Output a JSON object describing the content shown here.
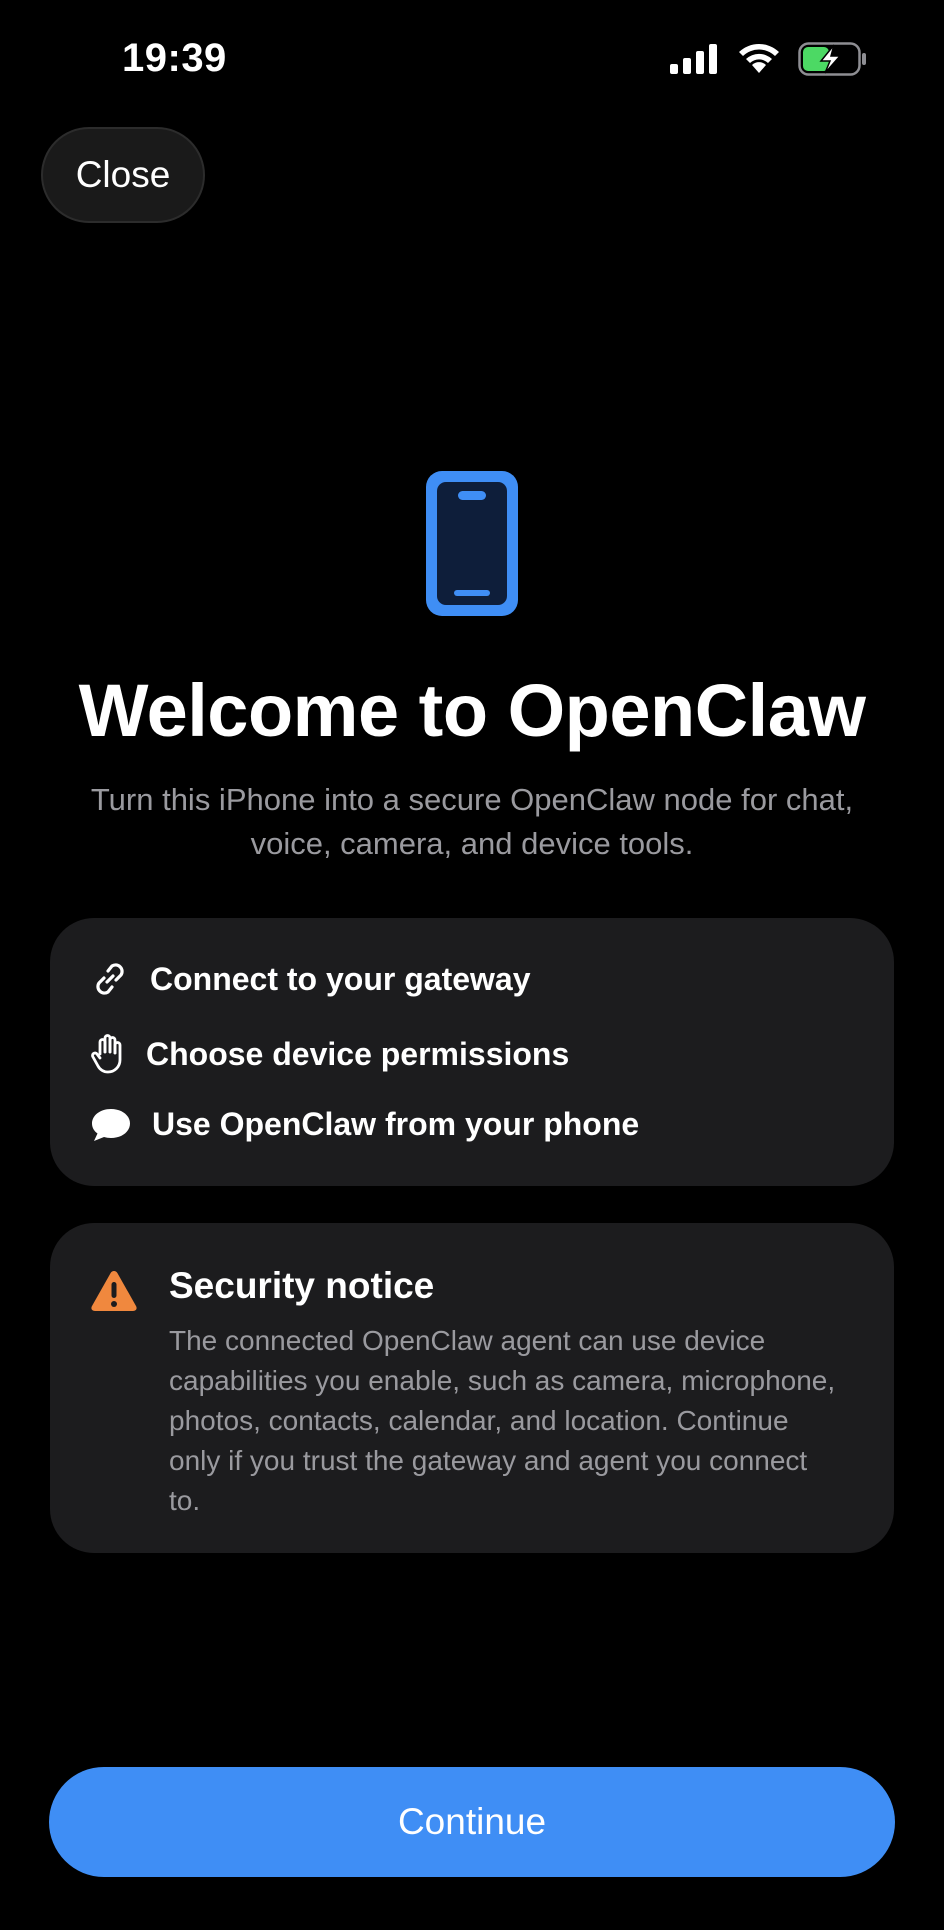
{
  "status_bar": {
    "time": "19:39",
    "icons": [
      "cellular-signal-icon",
      "wifi-icon",
      "battery-charging-icon"
    ],
    "battery_color": "#4cd964"
  },
  "close_button": {
    "label": "Close"
  },
  "hero": {
    "icon": "iphone-icon",
    "icon_color": "#3f8ef5",
    "title": "Welcome to OpenClaw",
    "subtitle": "Turn this iPhone into a secure OpenClaw node for chat, voice, camera, and device tools."
  },
  "features": [
    {
      "icon": "link-icon",
      "label": "Connect to your gateway"
    },
    {
      "icon": "hand-raised-icon",
      "label": "Choose device permissions"
    },
    {
      "icon": "chat-bubble-icon",
      "label": "Use OpenClaw from your phone"
    }
  ],
  "security_notice": {
    "icon": "warning-triangle-icon",
    "icon_color": "#f0883e",
    "title": "Security notice",
    "body": "The connected OpenClaw agent can use device capabilities you enable, such as camera, microphone, photos, contacts, calendar, and location. Continue only if you trust the gateway and agent you connect to."
  },
  "continue_button": {
    "label": "Continue",
    "color": "#3f8ef5"
  }
}
